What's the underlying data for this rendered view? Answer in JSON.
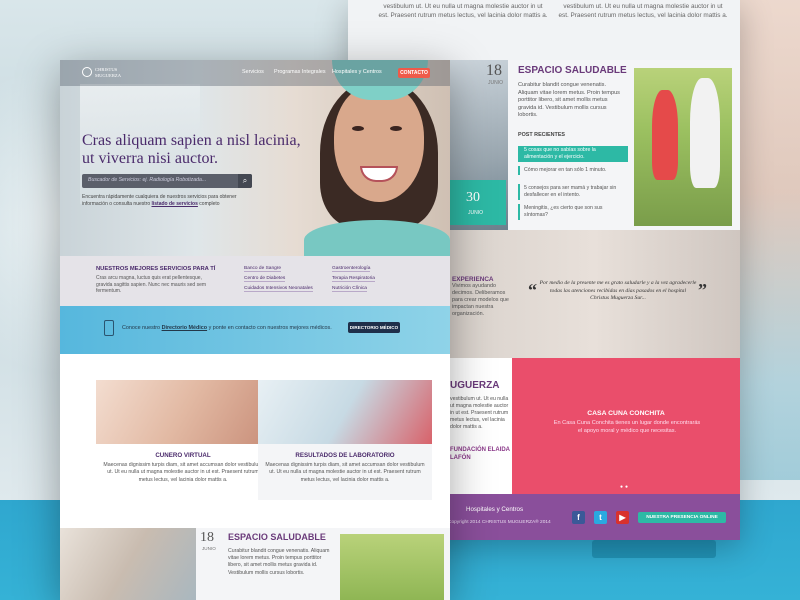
{
  "back_page": {
    "top_texts": [
      "vestibulum ut. Ut eu nulla ut magna molestie auctor in ut est. Praesent rutrum metus lectus, vel lacinia dolor mattis a.",
      "vestibulum ut. Ut eu nulla ut magna molestie auctor in ut est. Praesent rutrum metus lectus, vel lacinia dolor mattis a."
    ],
    "health": {
      "date_day": "18",
      "date_month": "JUNIO",
      "title": "ESPACIO SALUDABLE",
      "body": "Curabitur blandit congue venenatis. Aliquam vitae lorem metus. Proin tempus porttitor libero, sit amet mollis metus gravida id. Vestibulum mollis cursus lobortis.",
      "posts_title": "POST RECIENTES",
      "posts": [
        "5 cosas que no sabías sobre la alimentación y el ejercicio.",
        "Cómo mejorar en tan sólo 1 minuto.",
        "5 consejos para ser mamá y trabajar sin desfallecer en el intento.",
        "Meningitis, ¿es cierto que son sus síntomas?"
      ],
      "card_day": "30",
      "card_month": "JUNIO"
    },
    "experience": {
      "title": "EXPERIENCA",
      "body": "Vivimos ayudando decimos. Deliberamos para crear modelos que impactan nuestra organización."
    },
    "quote": {
      "text": "Por medio de la presente me es grato saludarle y a la vez agradecerle todas las atenciones recibidas en días pasados en el hospital",
      "author": "Christus Muguerza Sur..."
    },
    "muguerza": {
      "title": "UGUERZA",
      "body": "vestibulum ut. Ut eu nulla ut magna molestie auctor in ut est. Praesent rutrum metus lectus, vel lacinia dolor mattis a.",
      "foundation": "FUNDACIÓN ELAIDA LAFÓN"
    },
    "cuna": {
      "title": "CASA CUNA CONCHITA",
      "body": "En Casa Cuna Conchita tienes un lugar donde encontrarás el apoyo moral y médico que necesitas."
    },
    "footer": {
      "nav": "Hospitales y Centros",
      "copyright": "Copyright 2014 CHRISTUS MUGUERZA® 2014",
      "online_label": "NUESTRA PRESENCIA ONLINE",
      "social": [
        {
          "icon": "facebook-icon",
          "glyph": "f",
          "color": "#3b5998"
        },
        {
          "icon": "twitter-icon",
          "glyph": "t",
          "color": "#2aa9e0"
        },
        {
          "icon": "youtube-icon",
          "glyph": "▶",
          "color": "#d9312d"
        }
      ]
    }
  },
  "front_page": {
    "logo": {
      "line1": "CHRISTUS",
      "line2": "MUGUERZA"
    },
    "nav": [
      "Servicios",
      "Programas Integrales",
      "Hospitales y Centros"
    ],
    "contact_label": "CONTACTO",
    "hero": {
      "title": "Cras aliquam sapien a nisl lacinia, ut viverra nisi auctor.",
      "search_placeholder": "Buscador de Servicios: ej. Radiología Robotizada...",
      "help_text": "Encuentra rápidamente cualquiera de nuestros servicios para obtener información o consulta nuestro",
      "help_link": "listado de servicios",
      "help_suffix": "completo"
    },
    "services": {
      "title": "NUESTROS MEJORES SERVICIOS PARA TÍ",
      "body": "Cras arcu magna, luctus quis erat pellentesque, gravida sagittis sapien. Nunc nec mauris sed sem fermentum.",
      "links_col1": [
        "Banco de Sangre",
        "Centro de Diabetes",
        "Cuidados Intensivos Neonatales"
      ],
      "links_col2": [
        "Gastroenterología",
        "Terapia Respiratoria",
        "Nutrición Clínica"
      ]
    },
    "directory": {
      "text_prefix": "Conoce nuestro",
      "text_link": "Directorio Médico",
      "text_suffix": "y ponte en contacto con nuestros mejores médicos.",
      "button": "DIRECTORIO MÉDICO"
    },
    "cards": [
      {
        "title": "CUNERO VIRTUAL",
        "body": "Maecenas dignissim turpis diam, sit amet accumsan dolor vestibulum ut. Ut eu nulla ut magna molestie auctor in ut est. Praesent rutrum metus lectus, vel lacinia dolor mattis a."
      },
      {
        "title": "RESULTADOS DE LABORATORIO",
        "body": "Maecenas dignissim turpis diam, sit amet accumsan dolor vestibulum ut. Ut eu nulla ut magna molestie auctor in ut est. Praesent rutrum metus lectus, vel lacinia dolor mattis a."
      }
    ],
    "health": {
      "date_day": "18",
      "date_month": "JUNIO",
      "title": "ESPACIO SALUDABLE",
      "body": "Curabitur blandit congue venenatis. Aliquam vitae lorem metus. Proin tempus porttitor libero, sit amet mollis metus gravida id. Vestibulum mollis cursus lobortis."
    }
  },
  "colors": {
    "brand_purple": "#4a2a6b",
    "teal": "#2db9a5",
    "pink": "#ea4e6b",
    "contact": "#ef5a4a",
    "footer_purple": "#8a4f9b"
  }
}
